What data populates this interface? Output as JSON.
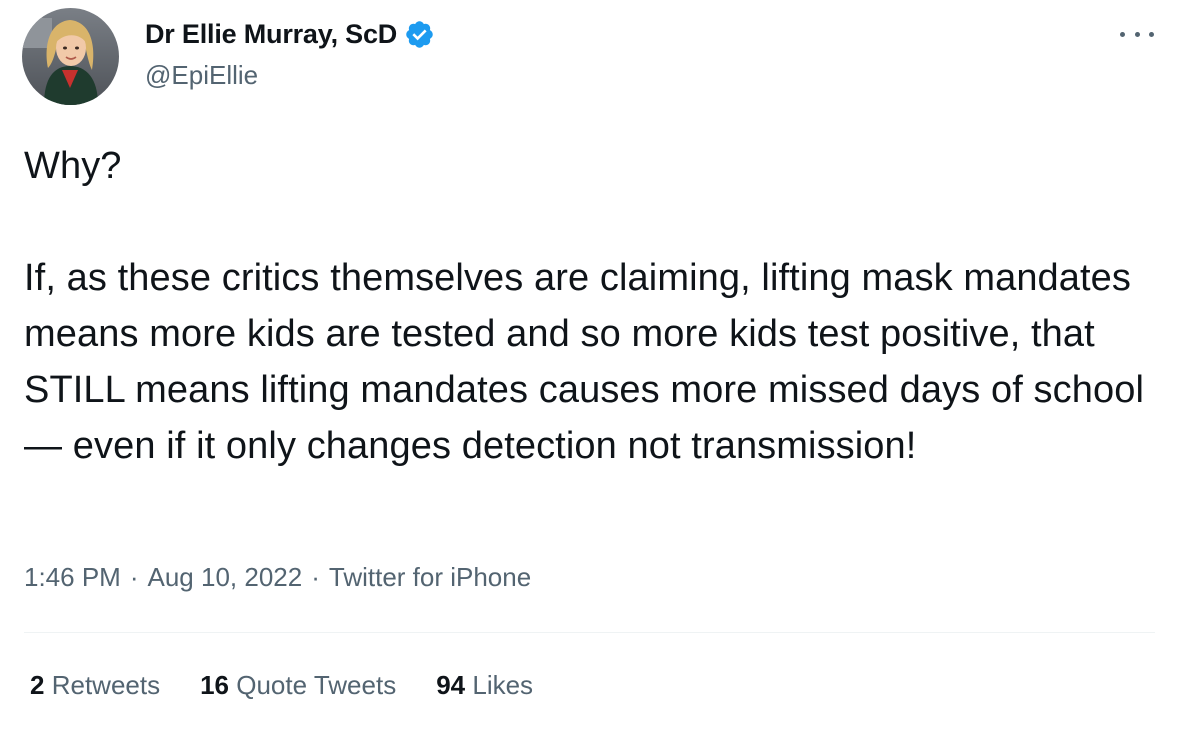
{
  "author": {
    "display_name": "Dr Ellie Murray, ScD",
    "handle": "@EpiEllie",
    "verified": true,
    "avatar_icon": "profile-photo",
    "verified_icon": "verified-badge-icon",
    "verified_color": "#1d9bf0"
  },
  "tweet": {
    "paragraph_1": "Why?",
    "paragraph_2": "If, as these critics themselves are claiming, lifting mask mandates means more kids are tested and so more kids test positive, that STILL means lifting mandates causes more missed days of school — even if it only changes detection not transmission!"
  },
  "meta": {
    "time": "1:46 PM",
    "separator": "·",
    "date": "Aug 10, 2022",
    "source": "Twitter for iPhone"
  },
  "stats": {
    "retweets_count": "2",
    "retweets_label": "Retweets",
    "quotes_count": "16",
    "quotes_label": "Quote Tweets",
    "likes_count": "94",
    "likes_label": "Likes"
  },
  "colors": {
    "text_primary": "#0f1419",
    "text_secondary": "#536471",
    "divider": "#eff3f4",
    "accent": "#1d9bf0"
  }
}
